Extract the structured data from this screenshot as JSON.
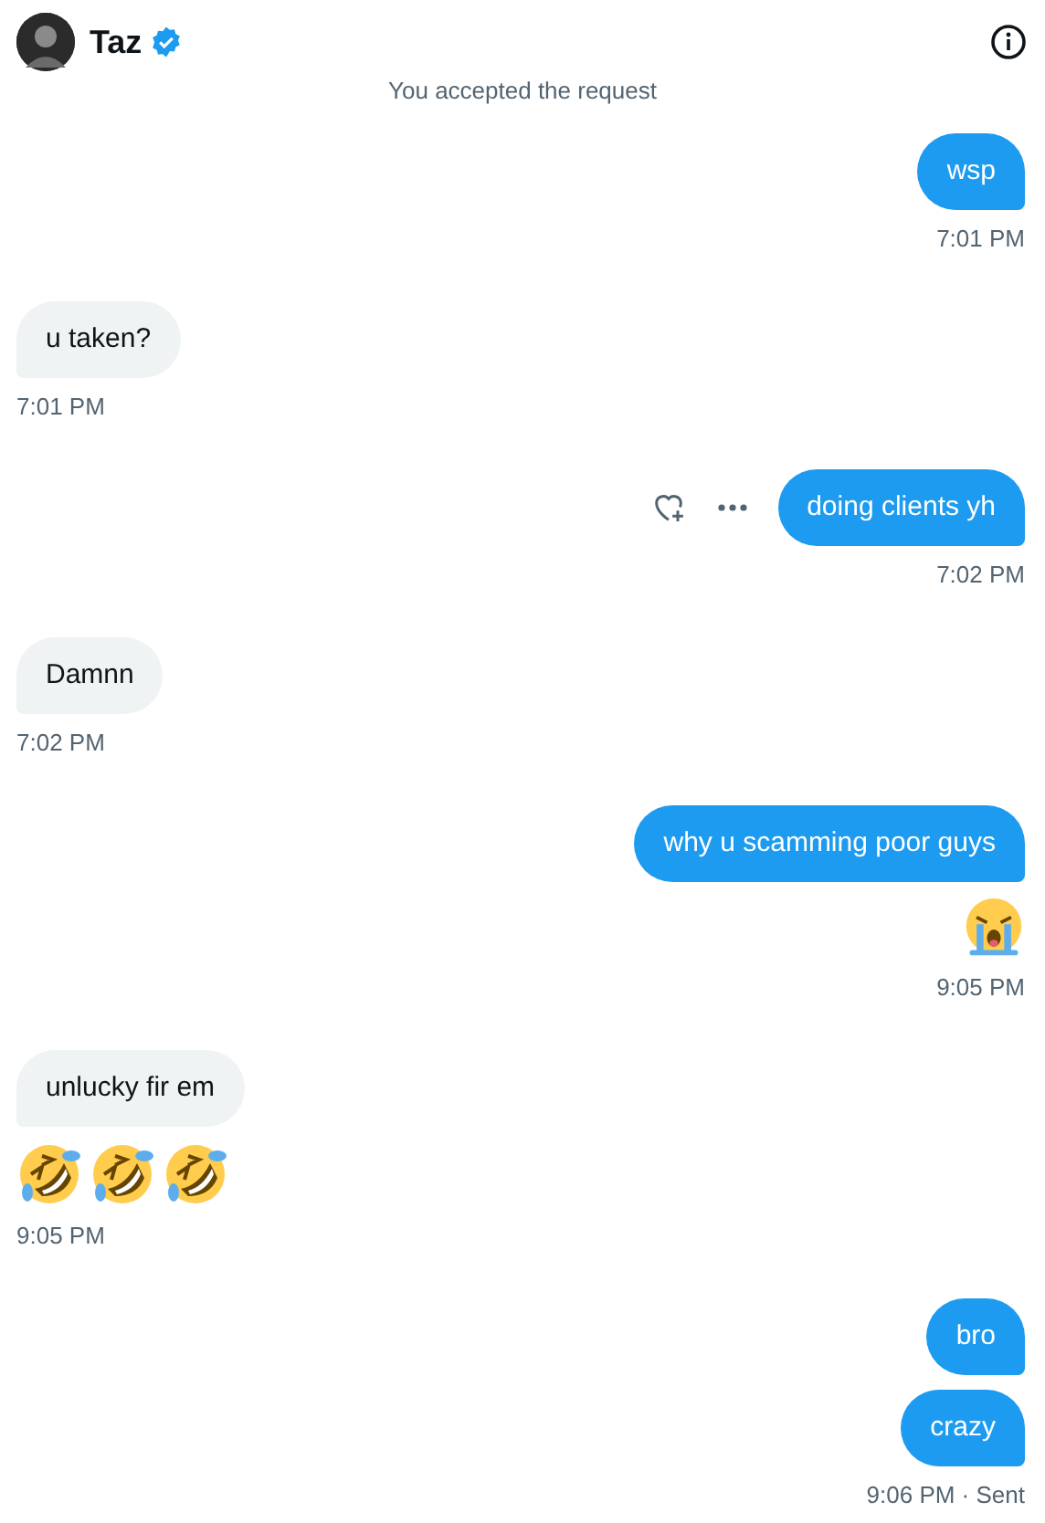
{
  "header": {
    "name": "Taz",
    "verified": true
  },
  "notice": "You accepted the request",
  "groups": [
    {
      "outgoing": true,
      "items": [
        {
          "kind": "text",
          "text": "wsp"
        }
      ],
      "time": "7:01 PM"
    },
    {
      "outgoing": false,
      "items": [
        {
          "kind": "text",
          "text": "u taken?"
        }
      ],
      "time": "7:01 PM"
    },
    {
      "outgoing": true,
      "items": [
        {
          "kind": "text",
          "text": "doing clients yh"
        }
      ],
      "time": "7:02 PM",
      "actions": true
    },
    {
      "outgoing": false,
      "items": [
        {
          "kind": "text",
          "text": "Damnn"
        }
      ],
      "time": "7:02 PM"
    },
    {
      "outgoing": true,
      "items": [
        {
          "kind": "text",
          "text": "why u scamming poor guys"
        },
        {
          "kind": "emoji",
          "faces": [
            {
              "kind": "crying"
            }
          ]
        }
      ],
      "time": "9:05 PM"
    },
    {
      "outgoing": false,
      "items": [
        {
          "kind": "text",
          "text": "unlucky fir em"
        },
        {
          "kind": "emoji",
          "faces": [
            {
              "kind": "rofl"
            },
            {
              "kind": "rofl"
            },
            {
              "kind": "rofl"
            }
          ]
        }
      ],
      "time": "9:05 PM"
    },
    {
      "outgoing": true,
      "items": [
        {
          "kind": "text",
          "text": "bro"
        },
        {
          "kind": "text",
          "text": "crazy"
        }
      ],
      "time": "9:06 PM · Sent"
    }
  ]
}
